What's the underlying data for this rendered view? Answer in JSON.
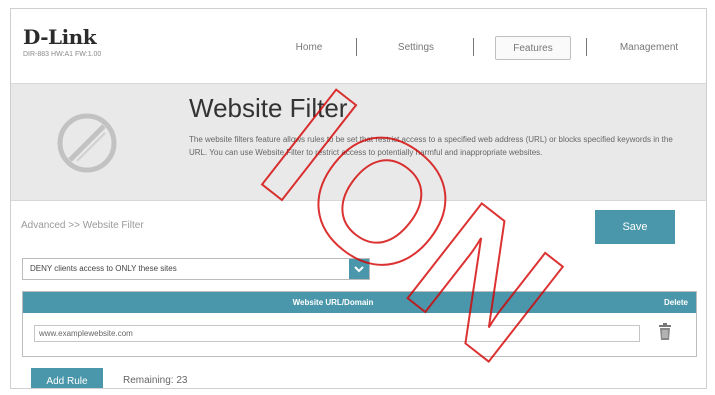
{
  "brand": {
    "logo": "D-Link",
    "subtitle": "DIR-883 HW:A1 FW:1.00"
  },
  "nav": {
    "items": [
      {
        "label": "Home"
      },
      {
        "label": "Settings"
      },
      {
        "label": "Features"
      },
      {
        "label": "Management"
      }
    ],
    "active": "Features"
  },
  "banner": {
    "title": "Website Filter",
    "description": "The website filters feature allows rules to be set that restrict access to a specified web address (URL) or blocks specified keywords in the URL. You can use Website Filter to restrict access to potentially harmful and inappropriate websites."
  },
  "breadcrumb": "Advanced >> Website Filter",
  "save_label": "Save",
  "filter_mode": {
    "selected": "DENY clients access to ONLY these sites"
  },
  "table": {
    "col_url": "Website URL/Domain",
    "col_delete": "Delete",
    "rows": [
      {
        "url": "www.examplewebsite.com"
      }
    ]
  },
  "add_rule_label": "Add Rule",
  "remaining_text": "Remaining: 23",
  "watermark_text": "ION",
  "colors": {
    "accent": "#4a97ab",
    "banner": "#e9e9e9",
    "watermark": "#d40000"
  }
}
